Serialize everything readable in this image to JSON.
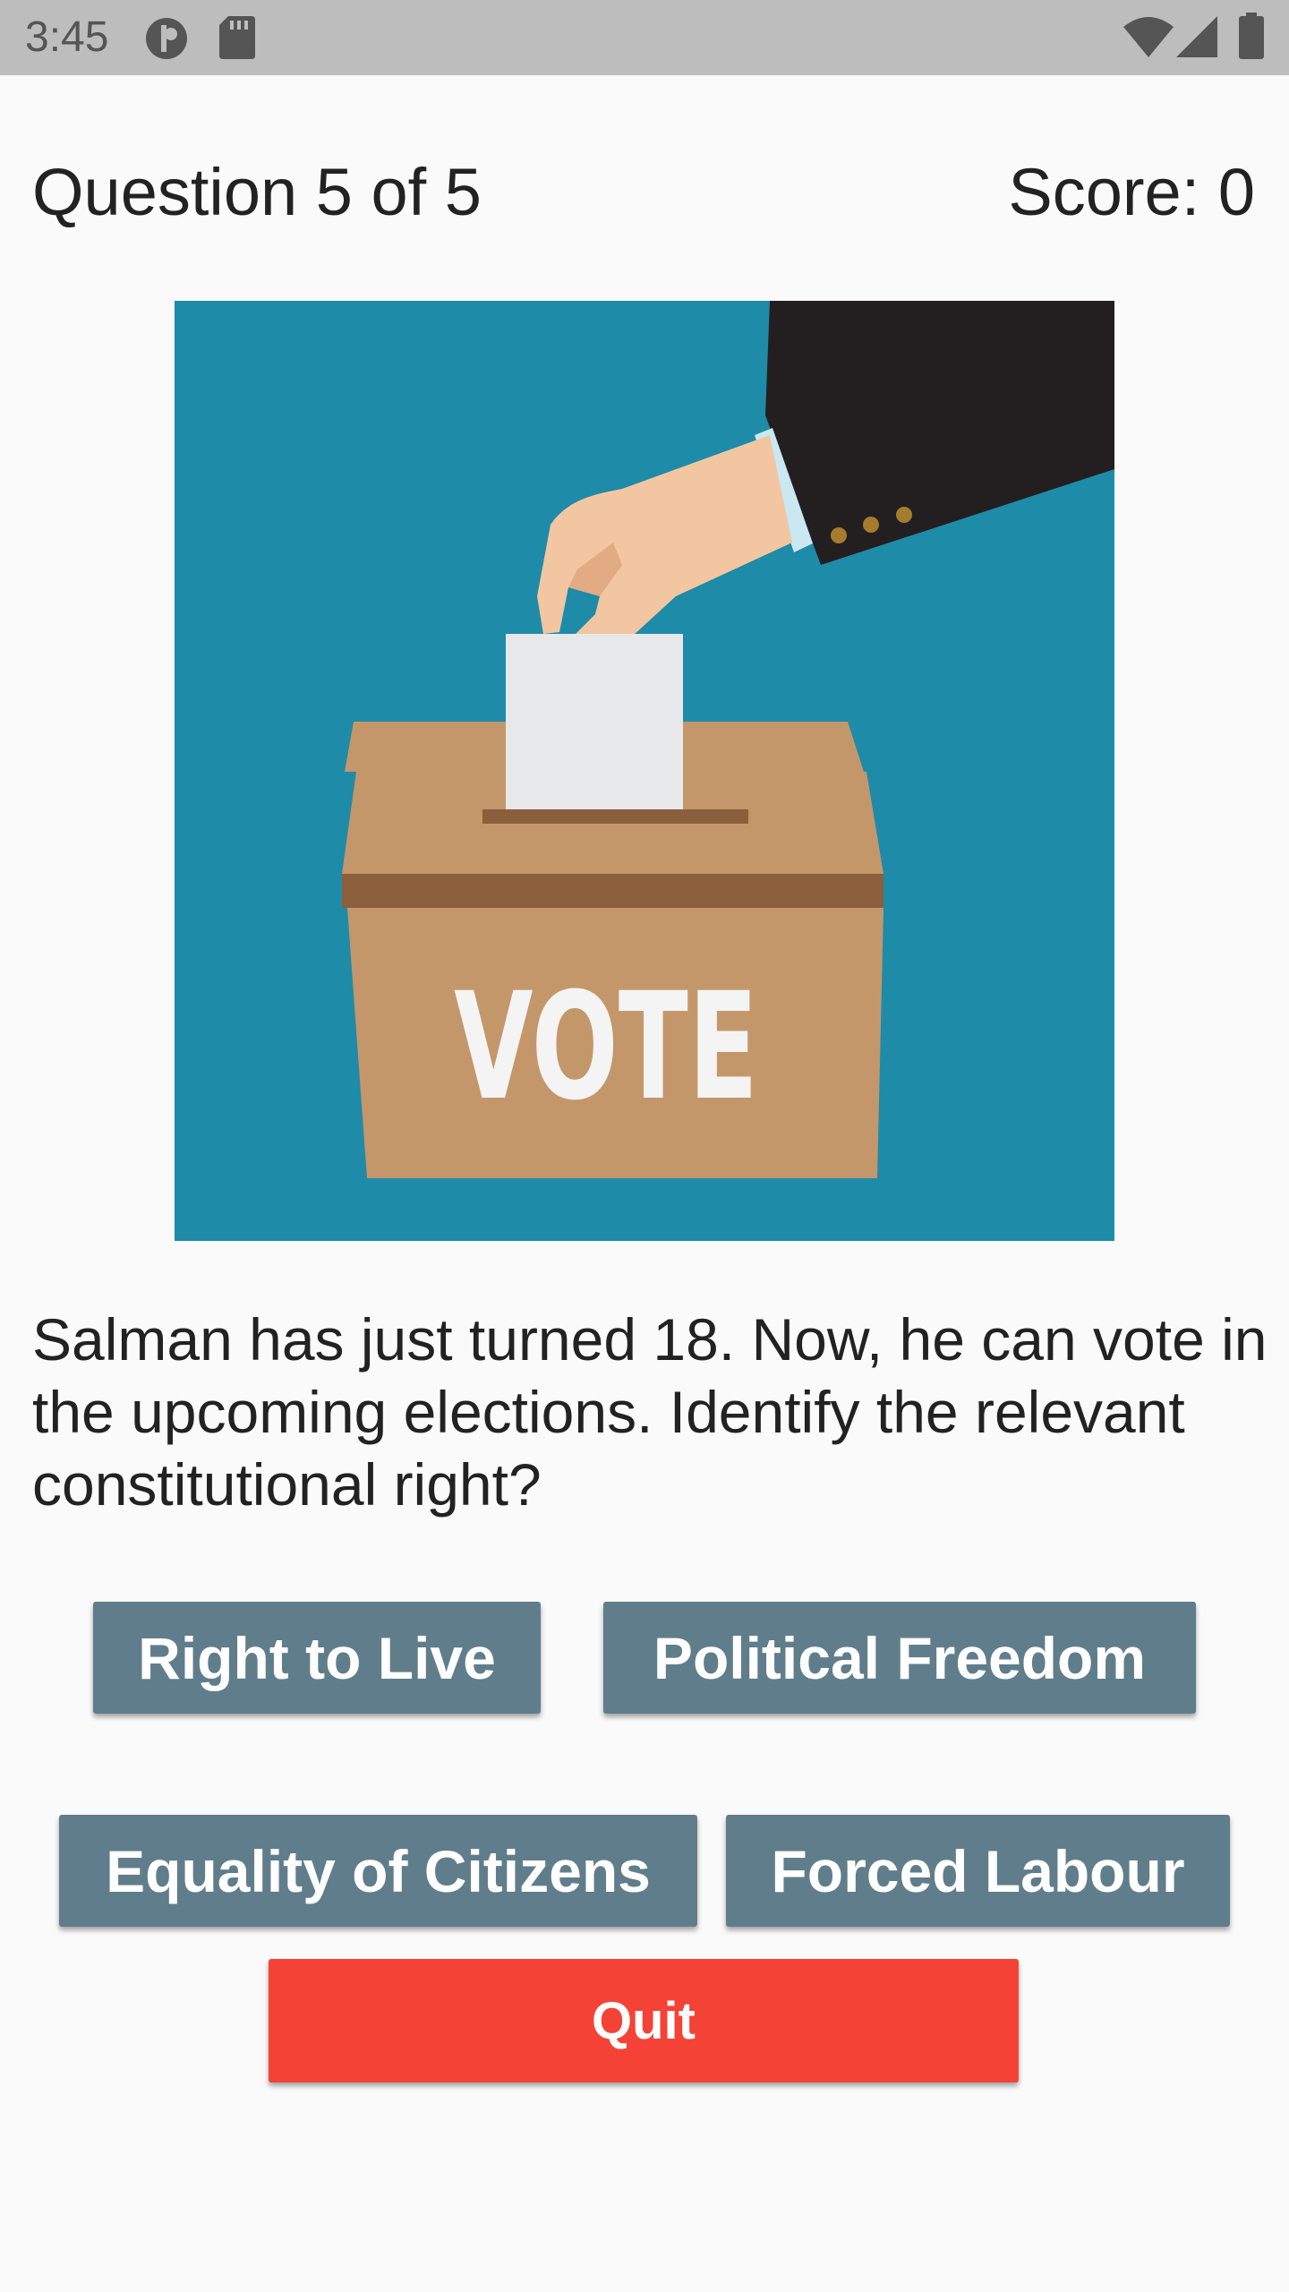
{
  "status_bar": {
    "time": "3:45",
    "icons": [
      "media-icon",
      "sd-card-icon",
      "wifi-icon",
      "signal-icon",
      "battery-icon"
    ]
  },
  "quiz": {
    "question_counter": "Question 5 of 5",
    "score_label": "Score: 0",
    "image": {
      "box_label": "VOTE",
      "colors": {
        "background": "#1e8ba8",
        "box": "#c4976a",
        "box_band": "#8b5e3c",
        "ballot": "#e7e8ea",
        "sleeve": "#231f20",
        "hand": "#f2c6a0"
      }
    },
    "question_text": "Salman has just turned 18. Now, he can vote in the upcoming elections. Identify the relevant constitutional right?",
    "answers": [
      "Right to Live",
      "Political Freedom",
      "Equality of Citizens",
      "Forced Labour"
    ],
    "quit_label": "Quit"
  },
  "colors": {
    "answer_button": "#607d8b",
    "quit_button": "#f44336",
    "status_bar": "#bdbdbd"
  }
}
